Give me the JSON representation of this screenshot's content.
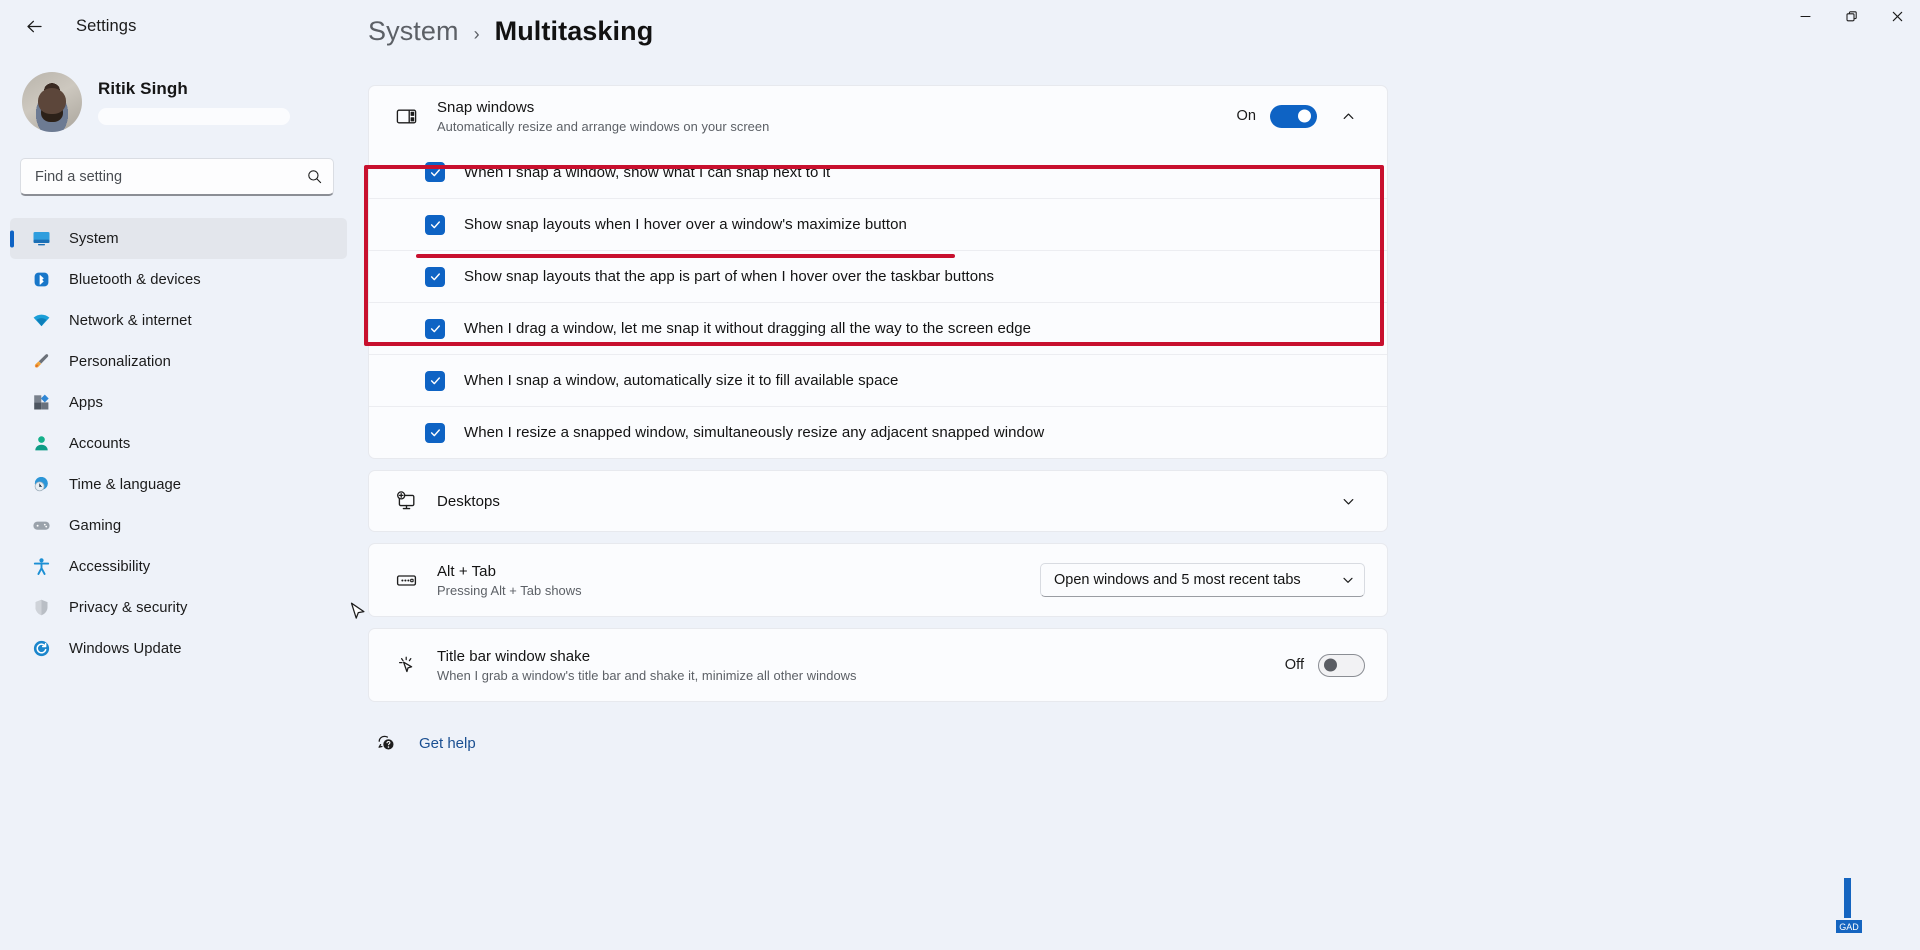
{
  "window": {
    "app_title": "Settings",
    "back_icon": "back-arrow-icon",
    "controls": {
      "minimize": "minimize-icon",
      "maximize": "restore-icon",
      "close": "close-icon"
    }
  },
  "profile": {
    "name": "Ritik Singh",
    "email_hidden": ""
  },
  "search": {
    "placeholder": "Find a setting",
    "value": "",
    "icon": "search-icon"
  },
  "sidebar": {
    "items": [
      {
        "label": "System",
        "icon": "monitor-icon",
        "active": true
      },
      {
        "label": "Bluetooth & devices",
        "icon": "bluetooth-icon",
        "active": false
      },
      {
        "label": "Network & internet",
        "icon": "wifi-icon",
        "active": false
      },
      {
        "label": "Personalization",
        "icon": "paintbrush-icon",
        "active": false
      },
      {
        "label": "Apps",
        "icon": "apps-icon",
        "active": false
      },
      {
        "label": "Accounts",
        "icon": "person-icon",
        "active": false
      },
      {
        "label": "Time & language",
        "icon": "clock-globe-icon",
        "active": false
      },
      {
        "label": "Gaming",
        "icon": "gamepad-icon",
        "active": false
      },
      {
        "label": "Accessibility",
        "icon": "accessibility-icon",
        "active": false
      },
      {
        "label": "Privacy & security",
        "icon": "shield-icon",
        "active": false
      },
      {
        "label": "Windows Update",
        "icon": "update-refresh-icon",
        "active": false
      }
    ]
  },
  "breadcrumb": {
    "parent": "System",
    "separator": "›",
    "current": "Multitasking"
  },
  "snap_windows": {
    "title": "Snap windows",
    "subtitle": "Automatically resize and arrange windows on your screen",
    "icon": "snap-layout-icon",
    "toggle_state": "On",
    "toggle_on": true,
    "expand_icon": "chevron-up-icon",
    "options": [
      {
        "label": "When I snap a window, show what I can snap next to it",
        "checked": true
      },
      {
        "label": "Show snap layouts when I hover over a window's maximize button",
        "checked": true
      },
      {
        "label": "Show snap layouts that the app is part of when I hover over the taskbar buttons",
        "checked": true
      },
      {
        "label": "When I drag a window, let me snap it without dragging all the way to the screen edge",
        "checked": true
      },
      {
        "label": "When I snap a window, automatically size it to fill available space",
        "checked": true
      },
      {
        "label": "When I resize a snapped window, simultaneously resize any adjacent snapped window",
        "checked": true
      }
    ]
  },
  "desktops": {
    "title": "Desktops",
    "icon": "desktop-add-icon",
    "expand_icon": "chevron-down-icon"
  },
  "alt_tab": {
    "title": "Alt + Tab",
    "subtitle": "Pressing Alt + Tab shows",
    "icon": "alt-tab-icon",
    "dropdown_value": "Open windows and 5 most recent tabs",
    "dropdown_icon": "chevron-down-icon"
  },
  "title_bar_shake": {
    "title": "Title bar window shake",
    "subtitle": "When I grab a window's title bar and shake it, minimize all other windows",
    "icon": "window-shake-icon",
    "toggle_state": "Off",
    "toggle_on": false
  },
  "get_help": {
    "label": "Get help",
    "icon": "help-question-icon"
  },
  "colors": {
    "accent": "#0e63c4",
    "annotation_red": "#c8102e",
    "link": "#1a4f91",
    "page_bg": "#eef2f9",
    "card_bg": "#fbfcfe"
  }
}
